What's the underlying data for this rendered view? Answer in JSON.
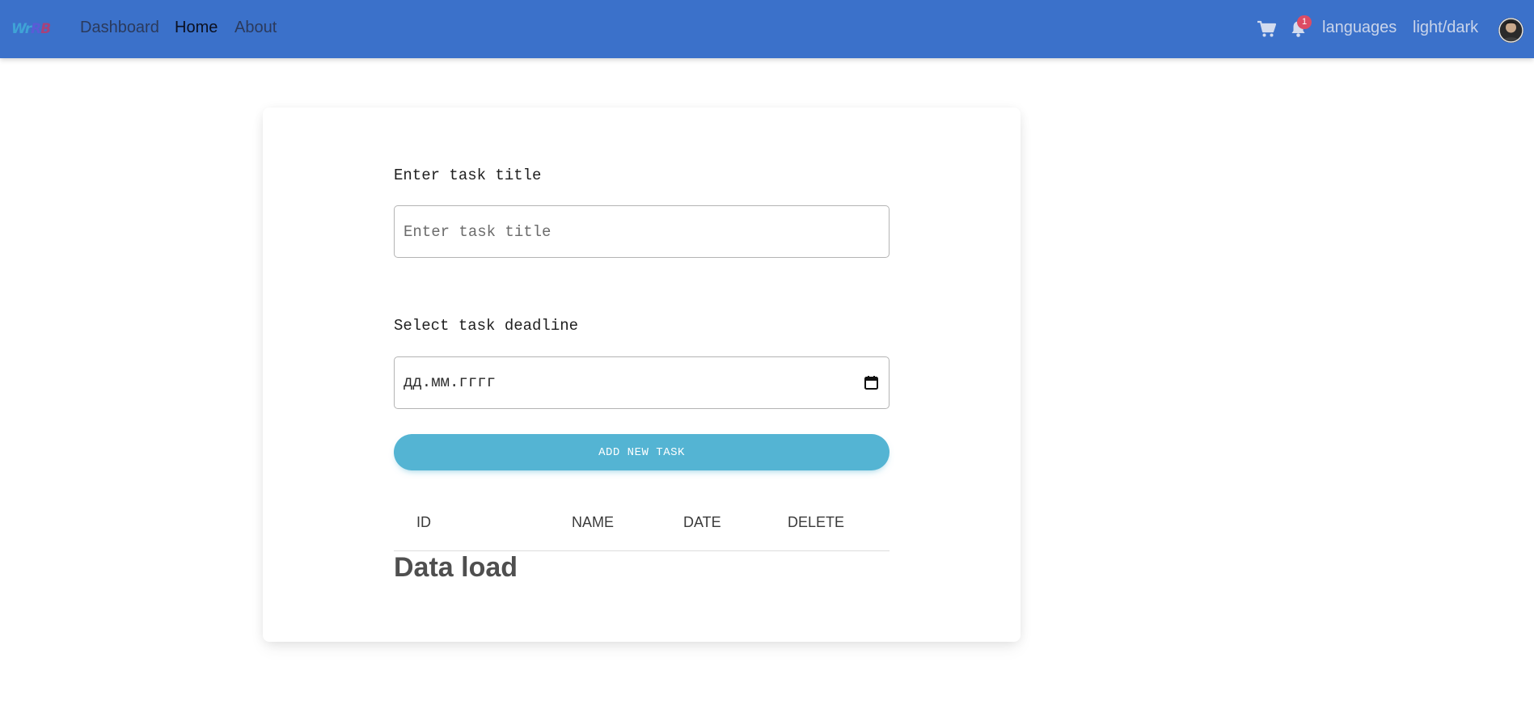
{
  "navbar": {
    "brand": [
      "Wr",
      "R",
      "B"
    ],
    "links": [
      {
        "label": "Dashboard"
      },
      {
        "label": "Home"
      },
      {
        "label": "About"
      }
    ],
    "notification_count": "1",
    "languages_label": "languages",
    "theme_label": "light/dark",
    "colors": {
      "background": "#3b71ca",
      "badge": "#dc4c64"
    }
  },
  "form": {
    "title_label": "Enter task title",
    "title_placeholder": "Enter task title",
    "title_value": "",
    "deadline_label": "Select task deadline",
    "deadline_placeholder": "дд.мм.гггг",
    "add_button_label": "ADD NEW TASK",
    "add_button_color": "#54b4d3"
  },
  "table": {
    "headers": [
      "ID",
      "NAME",
      "DATE",
      "DELETE"
    ],
    "loading_text": "Data load"
  },
  "icons": {
    "cart": "cart-icon",
    "bell": "bell-icon",
    "calendar": "calendar-icon",
    "avatar": "avatar"
  }
}
